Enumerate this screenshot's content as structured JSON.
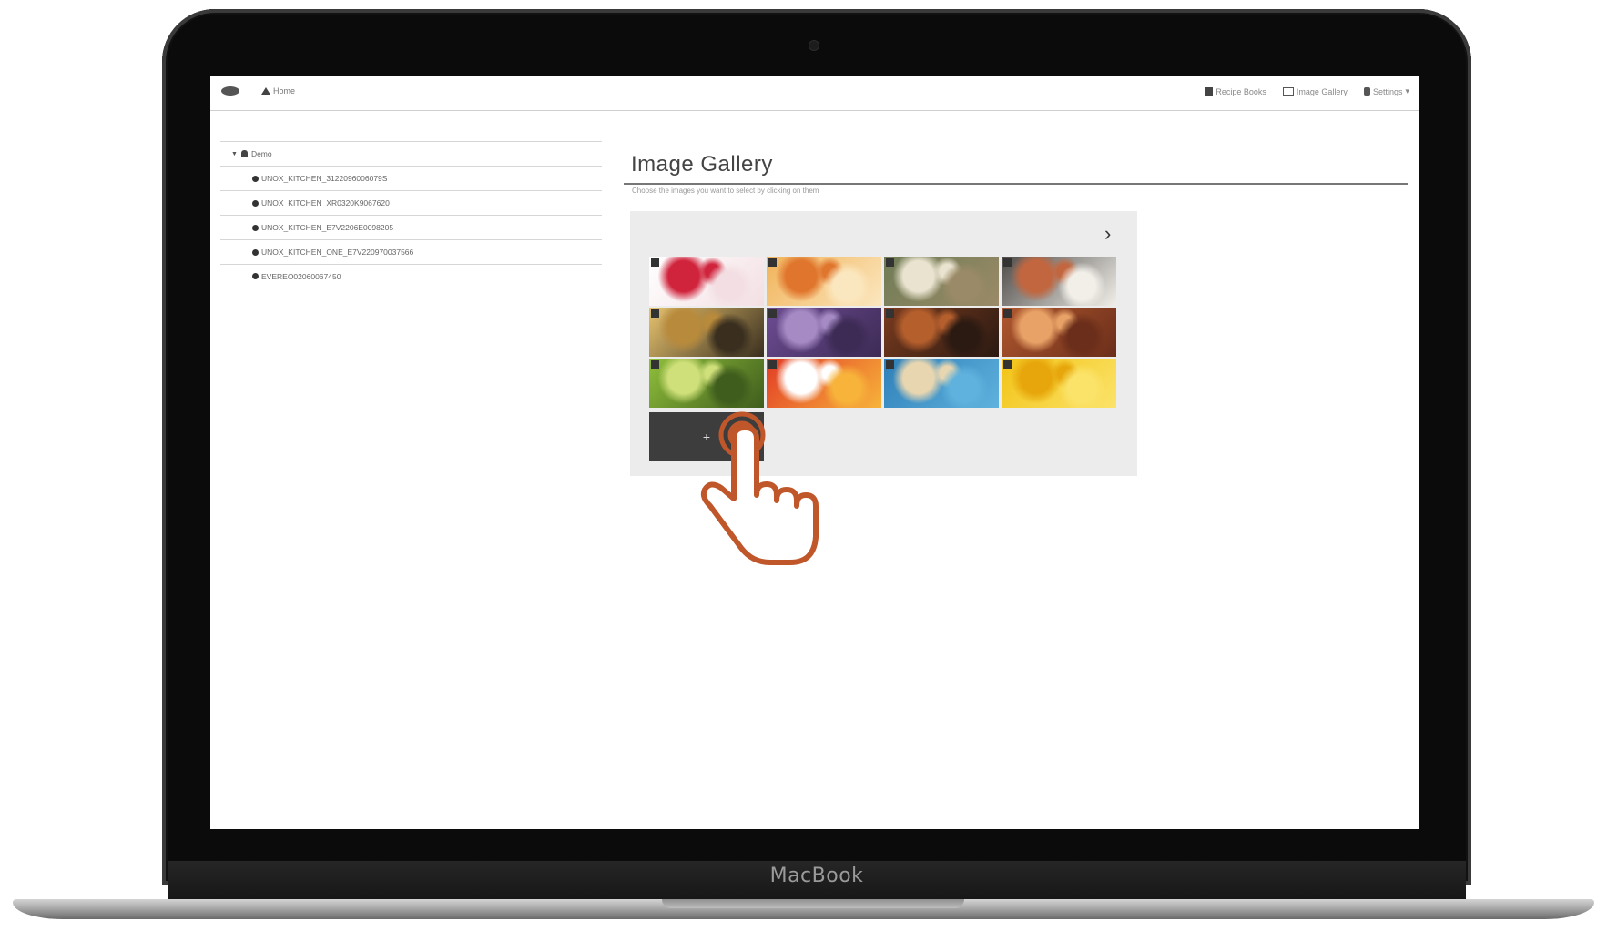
{
  "device": {
    "brand": "MacBook"
  },
  "navbar": {
    "home_label": "Home",
    "right_items": [
      {
        "label": "Recipe Books",
        "icon": "book-icon"
      },
      {
        "label": "Image Gallery",
        "icon": "picture-icon"
      },
      {
        "label": "Settings",
        "icon": "gear-icon"
      }
    ]
  },
  "sidebar": {
    "root_label": "Demo",
    "items": [
      {
        "label": "UNOX_KITCHEN_3122096006079S"
      },
      {
        "label": "UNOX_KITCHEN_XR0320K9067620"
      },
      {
        "label": "UNOX_KITCHEN_E7V2206E0098205"
      },
      {
        "label": "UNOX_KITCHEN_ONE_E7V220970037566"
      },
      {
        "label": "EVEREO02060067450"
      }
    ]
  },
  "main": {
    "title": "Image Gallery",
    "subtitle": "Choose the images you want to select by clicking on them",
    "upload_label": "+",
    "images": [
      {
        "name": "food-image-berry-tart",
        "colors": [
          "#ffffff",
          "#d0243c",
          "#f3dfe3"
        ]
      },
      {
        "name": "food-image-crepes",
        "colors": [
          "#f1b35a",
          "#e0762e",
          "#fbe7bf"
        ]
      },
      {
        "name": "food-image-dumplings-plate",
        "colors": [
          "#6f7c56",
          "#e9e3cf",
          "#9b8a67"
        ]
      },
      {
        "name": "food-image-canapes",
        "colors": [
          "#4d4a48",
          "#c2663f",
          "#f1efe8"
        ]
      },
      {
        "name": "food-image-flatbread",
        "colors": [
          "#e7c36f",
          "#b88a3c",
          "#3a2f1f"
        ]
      },
      {
        "name": "food-image-purple-potatoes",
        "colors": [
          "#6d4c93",
          "#a58ac4",
          "#3d2b55"
        ]
      },
      {
        "name": "food-image-roast-meat",
        "colors": [
          "#7a3b1f",
          "#b55f2d",
          "#2b1a12"
        ]
      },
      {
        "name": "food-image-baked-dish",
        "colors": [
          "#b0582f",
          "#e8a166",
          "#6b2e1a"
        ]
      },
      {
        "name": "food-image-green-peppers",
        "colors": [
          "#8fbf3b",
          "#cfe07a",
          "#3f5d1d"
        ]
      },
      {
        "name": "food-image-tomato-salad",
        "colors": [
          "#e23b26",
          "#ffffff",
          "#f7b33a"
        ]
      },
      {
        "name": "food-image-seafood-plate",
        "colors": [
          "#2e7fb8",
          "#e8d6b0",
          "#5fb2dd"
        ]
      },
      {
        "name": "food-image-saffron-rice",
        "colors": [
          "#f2c316",
          "#e7a70c",
          "#fbe36a"
        ]
      }
    ]
  },
  "accent": {
    "cursor_color": "#c0572a"
  }
}
